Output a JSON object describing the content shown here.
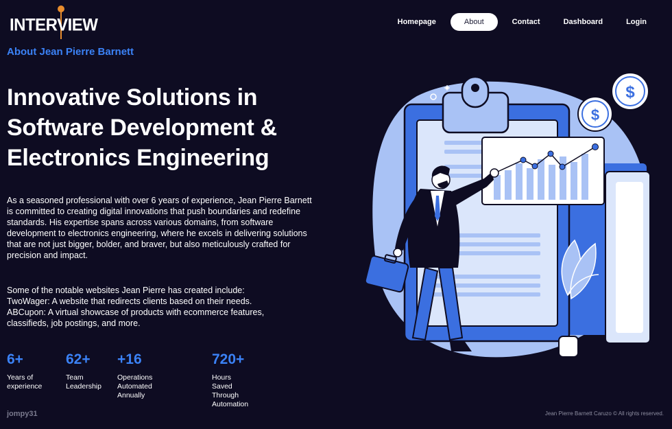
{
  "brand": {
    "logo_text": "INTERVIEW"
  },
  "nav": {
    "items": [
      {
        "label": "Homepage",
        "active": false
      },
      {
        "label": "About",
        "active": true
      },
      {
        "label": "Contact",
        "active": false
      },
      {
        "label": "Dashboard",
        "active": false
      },
      {
        "label": "Login",
        "active": false
      }
    ]
  },
  "about": {
    "title": "About Jean Pierre Barnett"
  },
  "hero": {
    "heading_lines": [
      "Innovative Solutions in",
      "Software Development &",
      "Electronics Engineering"
    ]
  },
  "intro": {
    "paragraph": "As a seasoned professional with over 6 years of experience, Jean Pierre Barnett is committed to creating digital innovations that push boundaries and redefine standards. His expertise spans across various domains, from software development to electronics engineering, where he excels in delivering solutions that are not just bigger, bolder, and braver, but also meticulously crafted for precision and impact."
  },
  "sites": {
    "lines": [
      "Some of the notable websites Jean Pierre has created include:",
      "TwoWager: A website that redirects clients based on their needs.",
      "ABCupon: A virtual showcase of products with ecommerce features,",
      "classifieds, job postings, and more."
    ]
  },
  "stats": [
    {
      "value": "6+",
      "label_lines": [
        "Years of",
        "experience"
      ]
    },
    {
      "value": "62+",
      "label_lines": [
        "Team",
        "Leadership"
      ]
    },
    {
      "value": "+16",
      "label_lines": [
        "Operations Automated",
        "Annually"
      ]
    },
    {
      "value": "720+",
      "label_lines": [
        "Hours Saved Through",
        "Automation"
      ]
    }
  ],
  "footer": {
    "left": "jompy31",
    "right": "Jean Pierre Barnett Caruzo © All rights reserved."
  },
  "illustration": {
    "coin_symbol": "$",
    "accent": "#3b6fe0",
    "light_blue": "#a9c2f5",
    "pale_blue": "#dbe6fb"
  },
  "colors": {
    "background": "#0e0c22",
    "accent": "#3b82f6",
    "logo_mic": "#e98d2d"
  }
}
